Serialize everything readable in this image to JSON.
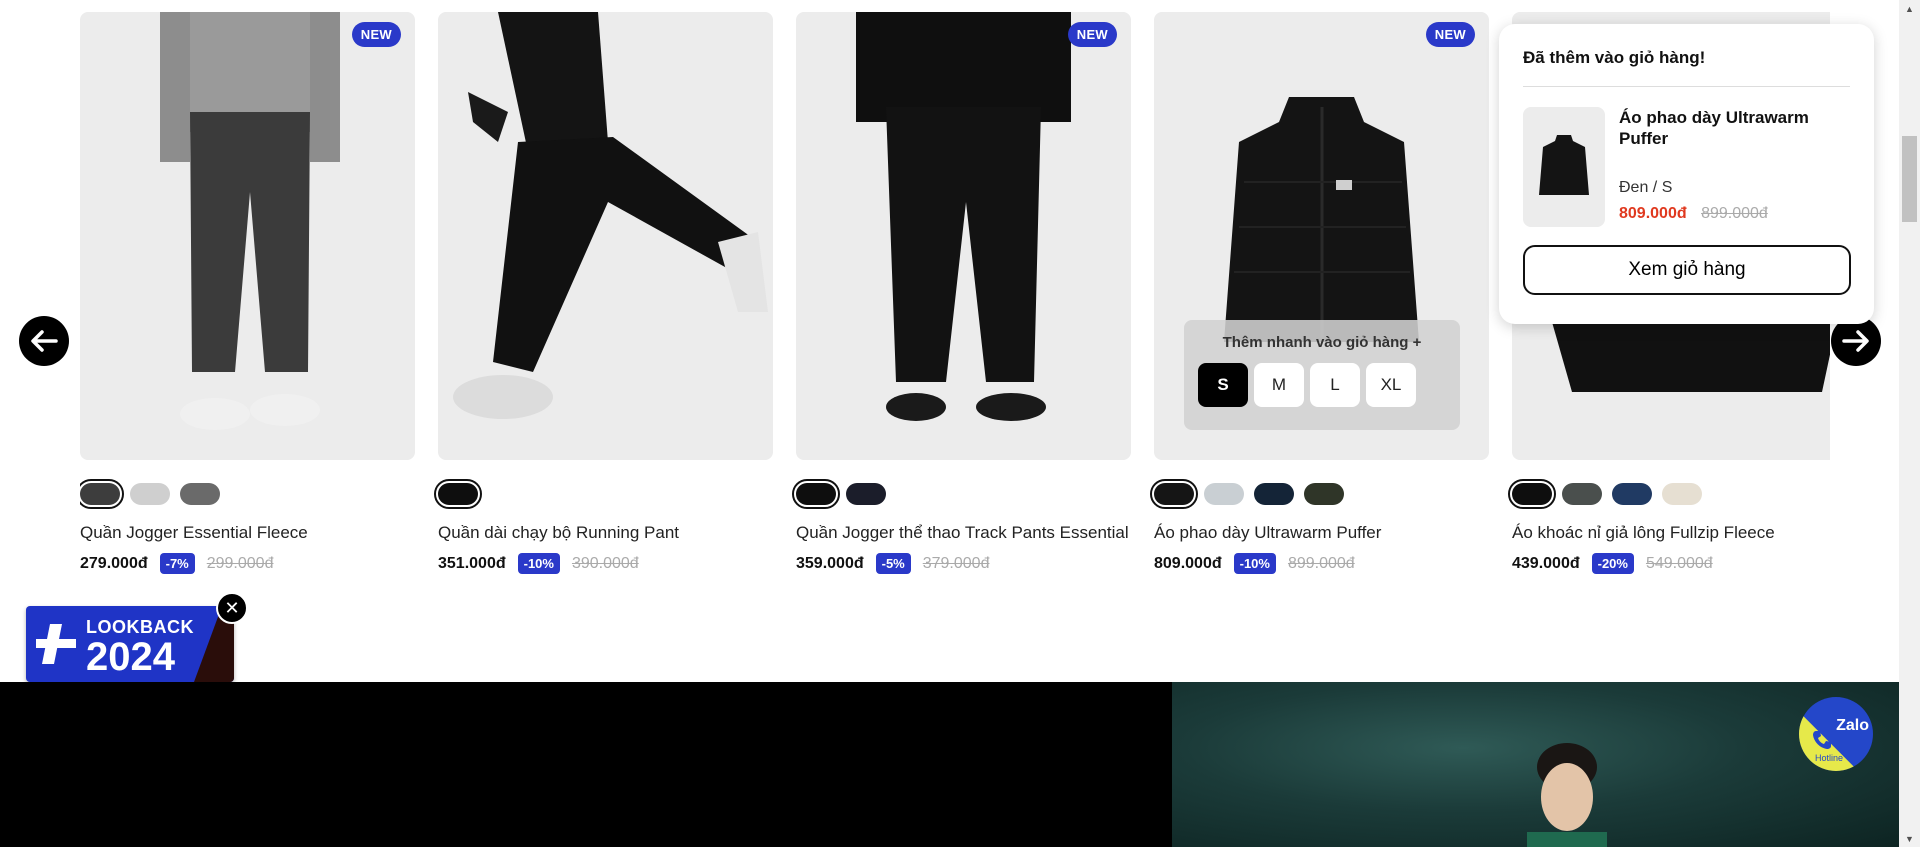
{
  "products": [
    {
      "name": "Quần Jogger Essential Fleece",
      "price": "279.000đ",
      "discount": "-7%",
      "old_price": "299.000đ",
      "badge": "NEW",
      "swatches": [
        "#3d3d3d",
        "#cfcfcf",
        "#6a6a6a"
      ]
    },
    {
      "name": "Quần dài chạy bộ Running Pant",
      "price": "351.000đ",
      "discount": "-10%",
      "old_price": "390.000đ",
      "badge": "",
      "swatches": [
        "#0e0e0e"
      ]
    },
    {
      "name": "Quần Jogger thể thao Track Pants Essential",
      "price": "359.000đ",
      "discount": "-5%",
      "old_price": "379.000đ",
      "badge": "NEW",
      "swatches": [
        "#0e0e0e",
        "#1b1d2a"
      ]
    },
    {
      "name": "Áo phao dày Ultrawarm Puffer",
      "price": "809.000đ",
      "discount": "-10%",
      "old_price": "899.000đ",
      "badge": "NEW",
      "swatches": [
        "#151515",
        "#c9cfd3",
        "#142437",
        "#2f3528"
      ]
    },
    {
      "name": "Áo khoác nỉ giả lông Fullzip Fleece",
      "price": "439.000đ",
      "discount": "-20%",
      "old_price": "549.000đ",
      "badge": "",
      "swatches": [
        "#0e0e0e",
        "#4a4f4d",
        "#203a63",
        "#e6dfd2"
      ]
    }
  ],
  "quick_add": {
    "title": "Thêm nhanh vào giỏ hàng +",
    "sizes": [
      "S",
      "M",
      "L",
      "XL"
    ],
    "selected": "S"
  },
  "cart_popup": {
    "title": "Đã thêm vào giỏ hàng!",
    "item_name": "Áo phao dày Ultrawarm Puffer",
    "variant": "Đen / S",
    "price": "809.000đ",
    "old_price": "899.000đ",
    "button": "Xem giỏ hàng"
  },
  "lookback": {
    "line1": "LOOKBACK",
    "line2": "2024"
  },
  "zalo": {
    "label": "Zalo",
    "hotline": "Hotline"
  },
  "icons": {
    "prev": "arrow-left-icon",
    "next": "arrow-right-icon",
    "close": "close-icon",
    "phone": "phone-icon"
  },
  "colors": {
    "accent": "#2a39c9",
    "sale_price": "#e0391f"
  }
}
